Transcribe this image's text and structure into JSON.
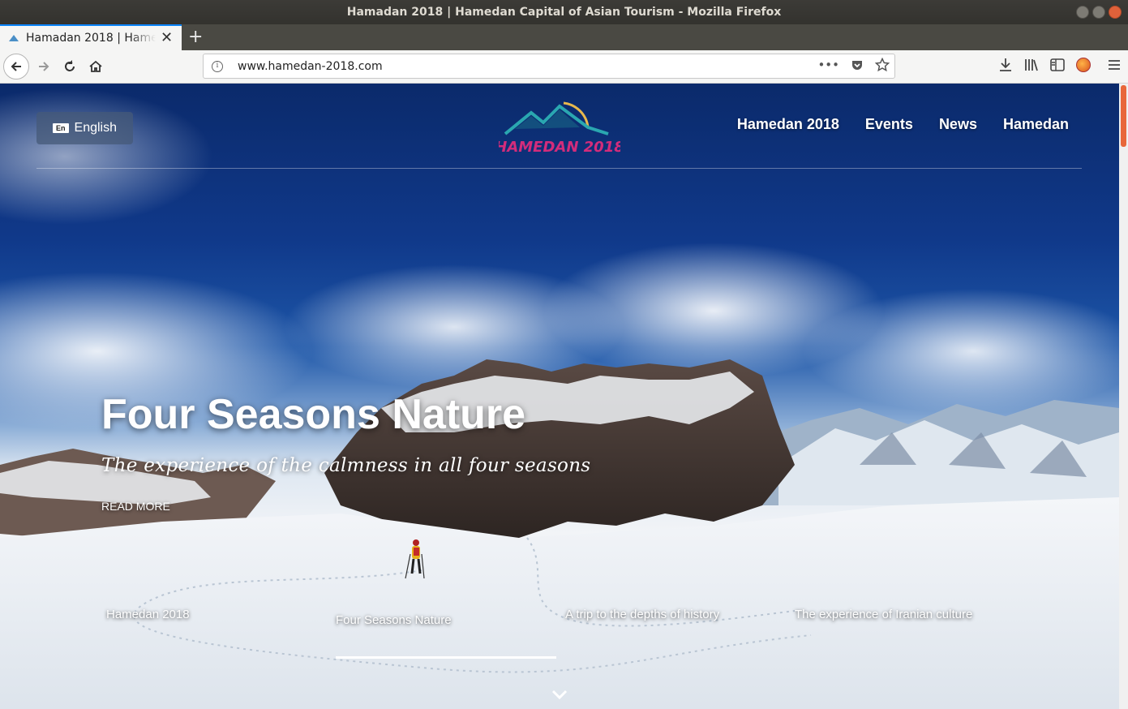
{
  "window": {
    "title": "Hamadan 2018 | Hamedan Capital of Asian Tourism - Mozilla Firefox"
  },
  "browser": {
    "tab_title": "Hamadan 2018 | Hamedan Capital of Asian Tourism",
    "url": "www.hamedan-2018.com"
  },
  "header": {
    "language_badge": "En",
    "language_label": "English",
    "logo_text": "HAMEDAN 2018",
    "nav": [
      "Hamedan 2018",
      "Events",
      "News",
      "Hamedan"
    ]
  },
  "hero": {
    "title": "Four Seasons Nature",
    "subtitle": "The experience of the calmness in all four seasons",
    "read_more": "READ MORE"
  },
  "slides": {
    "items": [
      "Hamedan 2018",
      "Four Seasons Nature",
      "A trip to the depths of history",
      "The experience of Iranian culture"
    ],
    "active_index": 1
  },
  "colors": {
    "accent": "#0a84ff",
    "scroll_thumb": "#e8673a",
    "sky_top": "#0b2a6b"
  },
  "icons": {
    "back": "back-arrow-icon",
    "forward": "forward-arrow-icon",
    "reload": "reload-icon",
    "home": "home-icon",
    "info": "info-icon",
    "more": "more-icon",
    "pocket": "pocket-icon",
    "bookmark": "star-icon",
    "download": "download-icon",
    "library": "library-icon",
    "sidebar": "sidebar-icon",
    "menu": "hamburger-menu-icon",
    "scroll_down": "chevron-down-icon"
  }
}
